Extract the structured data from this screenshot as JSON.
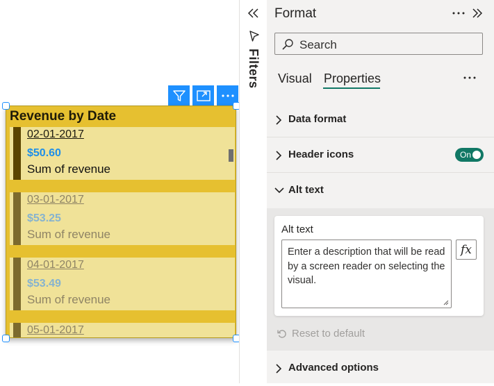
{
  "visual": {
    "title": "Revenue by Date",
    "rows": [
      {
        "date": "02-01-2017",
        "value": "$50.60",
        "label": "Sum of revenue",
        "state": "active"
      },
      {
        "date": "03-01-2017",
        "value": "$53.25",
        "label": "Sum of revenue",
        "state": "dim"
      },
      {
        "date": "04-01-2017",
        "value": "$53.49",
        "label": "Sum of revenue",
        "state": "dim"
      },
      {
        "date": "05-01-2017",
        "value": "",
        "label": "",
        "state": "dim"
      }
    ],
    "header_icons": [
      "filter-icon",
      "focus-mode-icon",
      "more-options-icon"
    ]
  },
  "filters_pane": {
    "label": "Filters",
    "collapse_icon": "double-chevron-left-icon",
    "filter_icon": "funnel-outline-icon"
  },
  "format_pane": {
    "title": "Format",
    "search": {
      "placeholder": "Search"
    },
    "tabs": [
      {
        "label": "Visual",
        "selected": false
      },
      {
        "label": "Properties",
        "selected": true
      }
    ],
    "sections": {
      "data_format": "Data format",
      "header_icons": {
        "label": "Header icons",
        "toggle_label": "On",
        "toggle_on": true
      },
      "alt_text": "Alt text",
      "advanced": "Advanced options"
    },
    "alt_text_card": {
      "caption": "Alt text",
      "value": "Enter a description that will be read by a screen reader on selecting the visual.",
      "fx_label": "fx"
    },
    "reset_label": "Reset to default"
  },
  "colors": {
    "accent_teal": "#117865",
    "visual_background": "#e6c030",
    "row_background": "#f0e298",
    "value_blue": "#1e8fe8",
    "header_button_blue": "#1e90ff"
  }
}
